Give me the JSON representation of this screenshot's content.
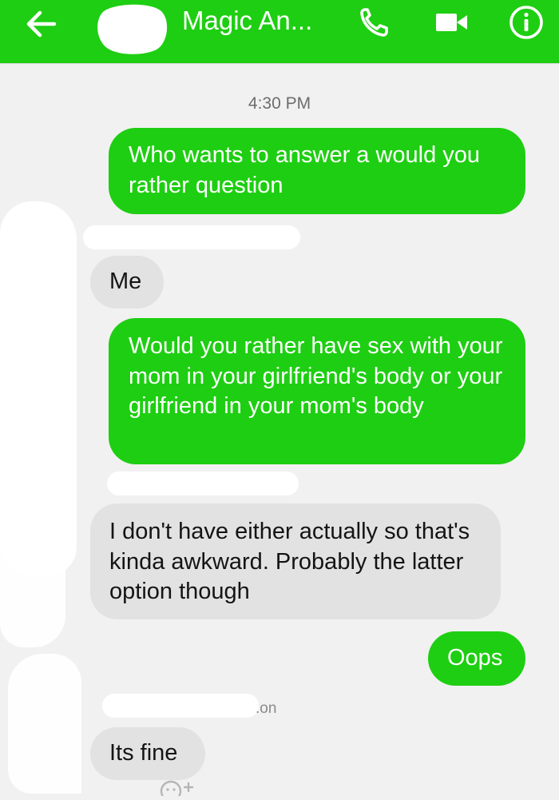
{
  "header": {
    "title": "Magic An...",
    "background": "#1ece12",
    "icons": {
      "back": "arrow-left-icon",
      "avatar": "avatar",
      "phone": "phone-icon",
      "video": "video-camera-icon",
      "info": "info-icon"
    }
  },
  "conversation": {
    "timestamp": "4:30 PM",
    "name_fragment": ".on",
    "messages": [
      {
        "direction": "outgoing",
        "text": "Who wants to answer a would you rather question"
      },
      {
        "direction": "incoming",
        "text": "Me"
      },
      {
        "direction": "outgoing",
        "text": "Would you rather have sex with your mom in your girlfriend's body or your girlfriend in your mom's body"
      },
      {
        "direction": "incoming",
        "text": "I don't have either actually so that's kinda awkward. Probably the latter option though"
      },
      {
        "direction": "outgoing",
        "text": "Oops"
      },
      {
        "direction": "incoming",
        "text": "Its fine"
      }
    ]
  },
  "colors": {
    "outgoing_bubble": "#1ece12",
    "incoming_bubble": "#e2e2e2",
    "background": "#f1f1f1"
  }
}
